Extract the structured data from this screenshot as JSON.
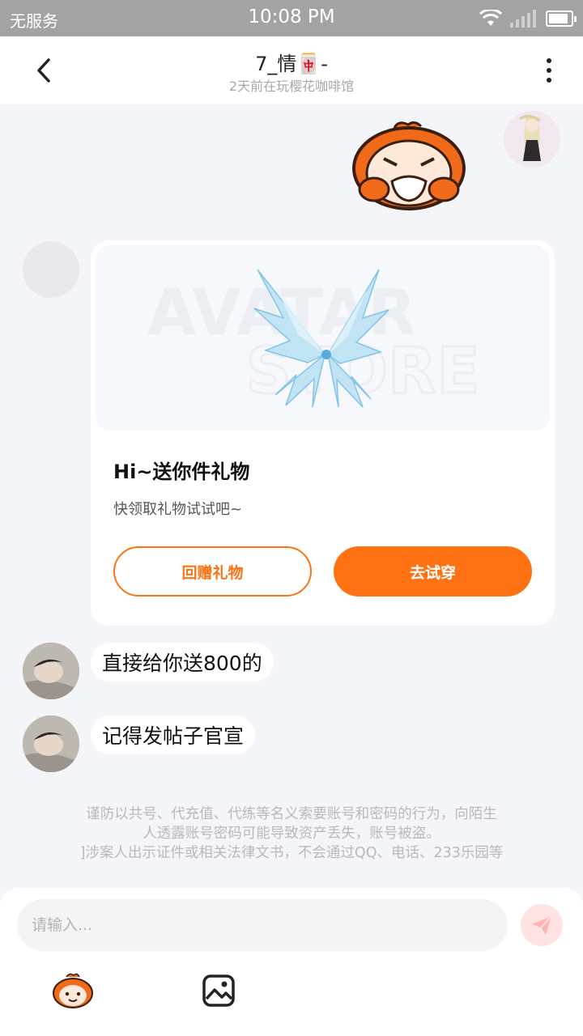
{
  "status_bar": {
    "carrier": "无服务",
    "time": "10:08 PM",
    "battery_level": 0.9
  },
  "header": {
    "title": "7_情🀄-",
    "subtitle": "2天前在玩樱花咖啡馆",
    "back_icon": "chevron-left-icon",
    "more_icon": "more-vertical-icon"
  },
  "gift_card": {
    "image_watermark": [
      "AVATAR",
      "STORE"
    ],
    "title": "Hi~送你件礼物",
    "description": "快领取礼物试试吧~",
    "return_gift_label": "回赠礼物",
    "try_on_label": "去试穿"
  },
  "messages": [
    {
      "text": "直接给你送800的"
    },
    {
      "text": "记得发帖子官宣"
    }
  ],
  "warning": {
    "lines": [
      "谨防以共号、代充值、代练等名义索要账号和密码的行为，向陌生",
      "人透露账号密码可能导致资产丢失，账号被盗。",
      "]涉案人出示证件或相关法律文书，不会通过QQ、电话、233乐园等"
    ]
  },
  "input": {
    "placeholder": "请输入..."
  },
  "colors": {
    "accent": "#ff7213",
    "background": "#f4f5f9",
    "status_bar": "#a3a3a3"
  }
}
